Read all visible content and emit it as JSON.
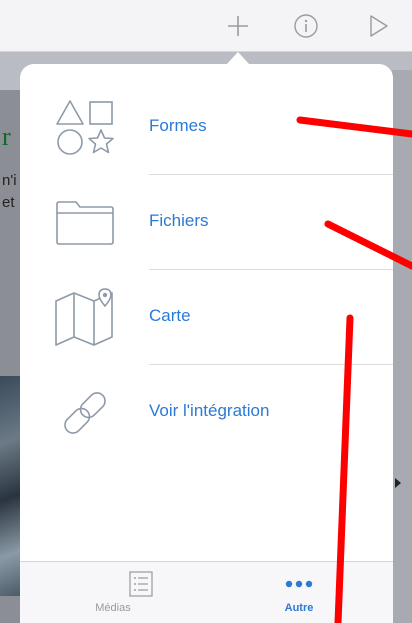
{
  "toolbar": {
    "buttons": [
      {
        "id": "add",
        "icon": "plus-icon"
      },
      {
        "id": "info",
        "icon": "info-icon"
      },
      {
        "id": "play",
        "icon": "play-icon"
      }
    ]
  },
  "background": {
    "text_r": "r",
    "line1": "n'i",
    "line2": "et"
  },
  "popover": {
    "items": [
      {
        "label": "Formes",
        "icon": "shapes-icon"
      },
      {
        "label": "Fichiers",
        "icon": "folder-icon"
      },
      {
        "label": "Carte",
        "icon": "map-icon"
      },
      {
        "label": "Voir l'intégration",
        "icon": "link-icon"
      }
    ],
    "tabs": [
      {
        "label": "Médias",
        "icon": "list-icon",
        "active": false
      },
      {
        "label": "Autre",
        "icon": "more-icon",
        "active": true
      }
    ]
  },
  "colors": {
    "accent": "#2a7ad6",
    "icon_gray": "#8e9aa8",
    "annotation": "#ff0000"
  }
}
